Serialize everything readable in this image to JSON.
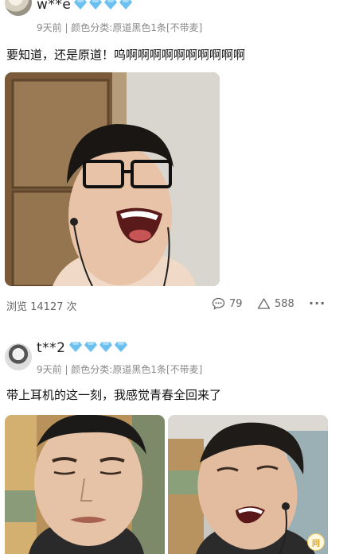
{
  "posts": [
    {
      "username": "w**e",
      "meta": "9天前 | 颜色分类:原道黑色1条[不带麦]",
      "content": "要知道，还是原道！呜啊啊啊啊啊啊啊啊啊啊",
      "views": "浏览 14127 次",
      "comments": "79",
      "likes": "588",
      "more": "···"
    },
    {
      "username": "t**2",
      "meta": "9天前 | 颜色分类:原道黑色1条[不带麦]",
      "content": "带上耳机的这一刻，我感觉青春全回来了"
    }
  ],
  "floating_badge": "问",
  "icons": [
    "diamond-icon",
    "comment-icon",
    "like-icon",
    "more-icon"
  ],
  "colors": {
    "diamond": "#6cc0f0",
    "meta_text": "#8a8a8a",
    "background": "#ffffff"
  }
}
